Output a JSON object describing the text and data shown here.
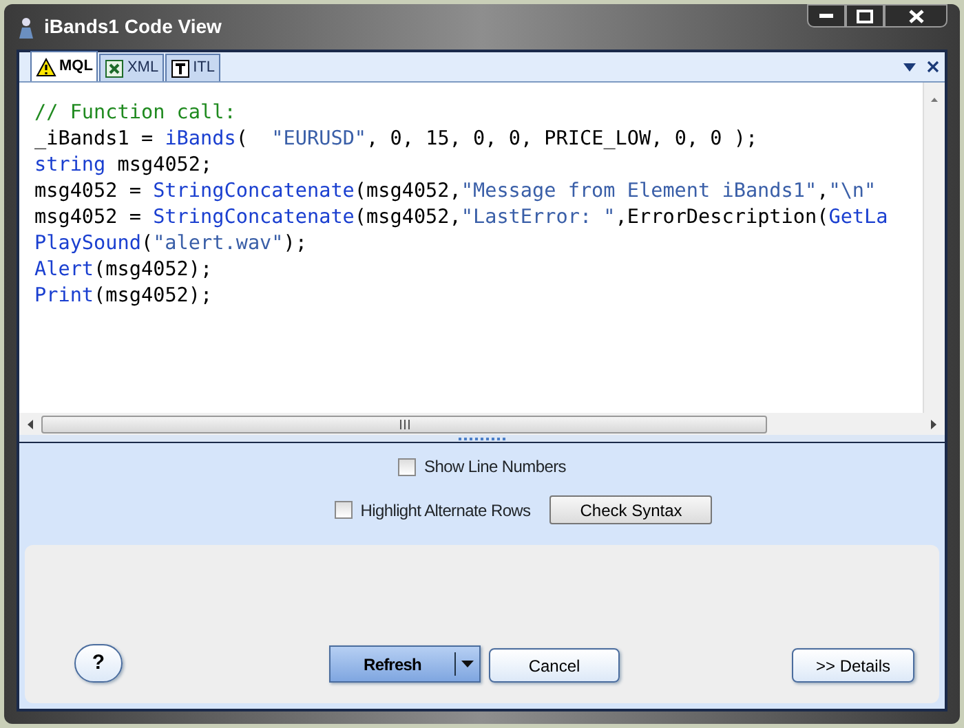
{
  "window": {
    "title": "iBands1 Code View"
  },
  "tabs": [
    {
      "label": "MQL",
      "kind": "warning",
      "selected": true
    },
    {
      "label": "XML",
      "kind": "sheet",
      "selected": false
    },
    {
      "label": "ITL",
      "kind": "text",
      "selected": false
    }
  ],
  "code": [
    [
      {
        "kind": "comment",
        "text": "// Function call:"
      }
    ],
    [
      {
        "kind": "plain",
        "text": "_iBands1 = "
      },
      {
        "kind": "func",
        "text": "iBands"
      },
      {
        "kind": "plain",
        "text": "(  "
      },
      {
        "kind": "string",
        "text": "\"EURUSD\""
      },
      {
        "kind": "plain",
        "text": ", 0, 15, 0, 0, PRICE_LOW, 0, 0 );"
      }
    ],
    [
      {
        "kind": "func",
        "text": "string"
      },
      {
        "kind": "plain",
        "text": " msg4052;"
      }
    ],
    [
      {
        "kind": "plain",
        "text": "msg4052 = "
      },
      {
        "kind": "func",
        "text": "StringConcatenate"
      },
      {
        "kind": "plain",
        "text": "(msg4052,"
      },
      {
        "kind": "string",
        "text": "\"Message from Element iBands1\""
      },
      {
        "kind": "plain",
        "text": ","
      },
      {
        "kind": "string",
        "text": "\"\\n\""
      }
    ],
    [
      {
        "kind": "plain",
        "text": "msg4052 = "
      },
      {
        "kind": "func",
        "text": "StringConcatenate"
      },
      {
        "kind": "plain",
        "text": "(msg4052,"
      },
      {
        "kind": "string",
        "text": "\"LastError: \""
      },
      {
        "kind": "plain",
        "text": ",ErrorDescription("
      },
      {
        "kind": "func",
        "text": "GetLa"
      }
    ],
    [
      {
        "kind": "func",
        "text": "PlaySound"
      },
      {
        "kind": "plain",
        "text": "("
      },
      {
        "kind": "string",
        "text": "\"alert.wav\""
      },
      {
        "kind": "plain",
        "text": ");"
      }
    ],
    [
      {
        "kind": "func",
        "text": "Alert"
      },
      {
        "kind": "plain",
        "text": "(msg4052);"
      }
    ],
    [
      {
        "kind": "func",
        "text": "Print"
      },
      {
        "kind": "plain",
        "text": "(msg4052);"
      }
    ]
  ],
  "options": [
    {
      "label": "Show Line Numbers",
      "checked": false
    },
    {
      "label": "Highlight Alternate Rows",
      "checked": false
    }
  ],
  "check_syntax_button": "Check Syntax",
  "help_button": "?",
  "buttons": [
    {
      "label": "Refresh",
      "kind": "split"
    },
    {
      "label": "Cancel",
      "kind": "plain"
    },
    {
      "label": ">> Details",
      "kind": "plain"
    }
  ]
}
